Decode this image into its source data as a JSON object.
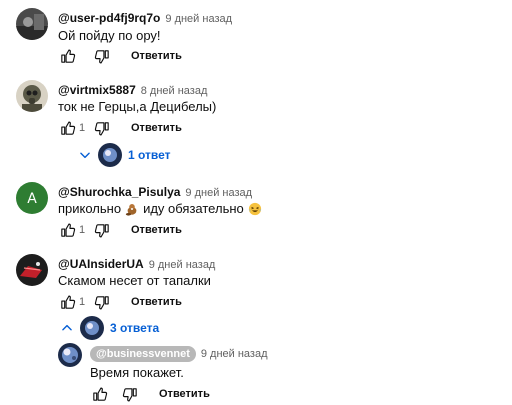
{
  "comments": [
    {
      "author": "@user-pd4fj9rq7o",
      "time": "9 дней назад",
      "text": "Ой пойду по ору!",
      "likes": "",
      "reply_label": "Ответить"
    },
    {
      "author": "@virtmix5887",
      "time": "8 дней назад",
      "text": "ток не Герцы,а Децибелы)",
      "likes": "1",
      "reply_label": "Ответить",
      "replies_label": "1 ответ"
    },
    {
      "author": "@Shurochka_Pisulya",
      "time": "9 дней назад",
      "avatar_letter": "А",
      "text_before": "прикольно",
      "text_after": "иду обязательно",
      "likes": "1",
      "reply_label": "Ответить"
    },
    {
      "author": "@UAInsiderUA",
      "time": "9 дней назад",
      "text": "Скамом несет от тапалки",
      "likes": "1",
      "reply_label": "Ответить",
      "replies_label": "3 ответа"
    }
  ],
  "reply": {
    "author": "@businessvennet",
    "time": "9 дней назад",
    "text": "Время покажет.",
    "reply_label": "Ответить"
  },
  "icons": [
    "like-icon",
    "dislike-icon",
    "chevron-down-icon",
    "chevron-up-icon"
  ],
  "colors": {
    "link_blue": "#065fd4",
    "avatar_green": "#2e7d32",
    "muted_text": "#606060"
  }
}
